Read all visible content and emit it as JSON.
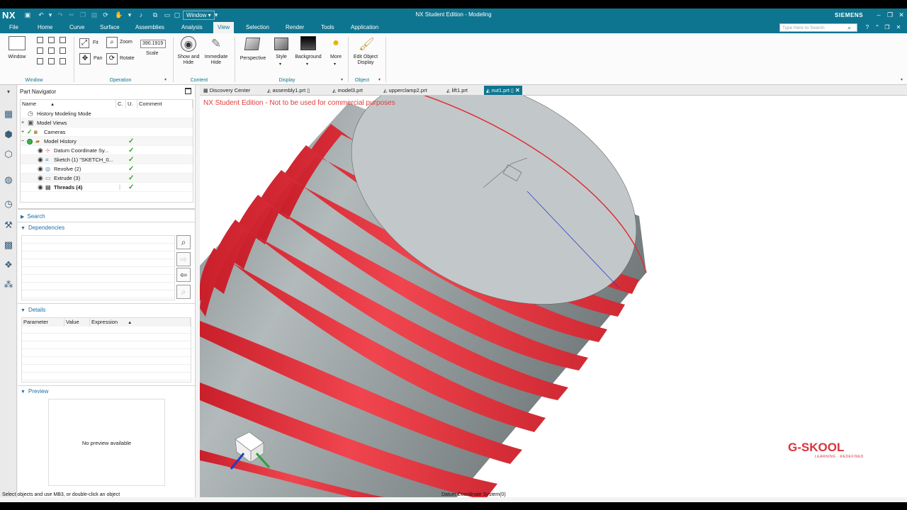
{
  "window": {
    "logo": "NX",
    "title": "NX Student Edition - Modeling",
    "brand": "SIEMENS",
    "window_menu": "Window ▾"
  },
  "menubar": {
    "items": [
      "File",
      "Home",
      "Curve",
      "Surface",
      "Assemblies",
      "Analysis",
      "View",
      "Selection",
      "Render",
      "Tools",
      "Application"
    ],
    "active": "View",
    "search_placeholder": "Type Here to Search"
  },
  "ribbon": {
    "window_group": {
      "label": "Window",
      "button": "Window"
    },
    "operation_group": {
      "label": "Operation",
      "fit": "Fit",
      "zoom": "Zoom",
      "pan": "Pan",
      "rotate": "Rotate",
      "scale_value": "390.1919",
      "scale_label": "Scale"
    },
    "content_group": {
      "label": "Content",
      "show_hide": "Show and Hide",
      "immediate_hide": "Immediate Hide"
    },
    "display_group": {
      "label": "Display",
      "perspective": "Perspective",
      "style": "Style",
      "background": "Background",
      "more": "More"
    },
    "object_group": {
      "label": "Object",
      "edit_object_display": "Edit Object Display"
    }
  },
  "part_navigator": {
    "title": "Part Navigator",
    "columns": {
      "name": "Name",
      "c": "C.",
      "u": "U.",
      "comment": "Comment"
    },
    "rows": [
      {
        "label": "History Modeling Mode"
      },
      {
        "label": "Model Views"
      },
      {
        "label": "Cameras"
      },
      {
        "label": "Model History"
      },
      {
        "label": "Datum Coordinate Sy..."
      },
      {
        "label": "Sketch (1) \"SKETCH_0..."
      },
      {
        "label": "Revolve (2)"
      },
      {
        "label": "Extrude (3)"
      },
      {
        "label": "Threads (4)"
      }
    ],
    "search": "Search",
    "dependencies": "Dependencies",
    "details": "Details",
    "details_columns": {
      "parameter": "Parameter",
      "value": "Value",
      "expression": "Expression"
    },
    "preview": "Preview",
    "preview_empty": "No preview available"
  },
  "tabs": [
    {
      "label": "Discovery Center"
    },
    {
      "label": "assembly1.prt"
    },
    {
      "label": "model3.prt"
    },
    {
      "label": "upperclamp2.prt"
    },
    {
      "label": "lift1.prt"
    },
    {
      "label": "nut1.prt"
    }
  ],
  "viewport": {
    "watermark": "NX Student Edition - Not to be used for commercial purposes",
    "logo_text": "G-SKOOL",
    "logo_tagline": "LEARNING · REDEFINED"
  },
  "status": {
    "left": "Select objects and use MB3, or double-click an object",
    "middle": "Datum Coordinate System(0)"
  },
  "colors": {
    "accent": "#0e7590",
    "thread_red": "#e8313c",
    "body_grey": "#9aa3a5"
  }
}
